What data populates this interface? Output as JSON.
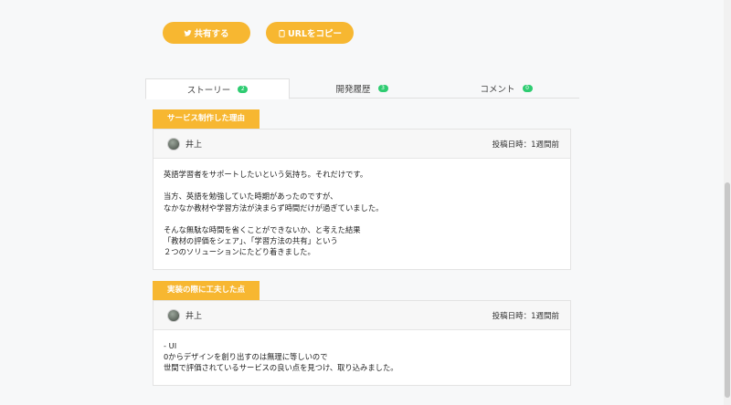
{
  "share": {
    "twitter_label": "共有する",
    "copy_label": "URLをコピー"
  },
  "tabs": [
    {
      "label": "ストーリー",
      "count": "2",
      "active": true
    },
    {
      "label": "開発履歴",
      "count": "3",
      "active": false
    },
    {
      "label": "コメント",
      "count": "0",
      "active": false
    }
  ],
  "sections": [
    {
      "title": "サービス制作した理由",
      "author": "井上",
      "posted": "投稿日時：1週間前",
      "lines": [
        "英語学習者をサポートしたいという気持ち。それだけです。",
        "",
        "当方、英語を勉強していた時期があったのですが、",
        "なかなか教材や学習方法が決まらず時間だけが過ぎていました。",
        "",
        "そんな無駄な時間を省くことができないか、と考えた結果",
        "「教材の評価をシェア」、「学習方法の共有」という",
        "２つのソリューションにたどり着きました。"
      ]
    },
    {
      "title": "実装の際に工夫した点",
      "author": "井上",
      "posted": "投稿日時：1週間前",
      "lines": [
        "- UI",
        "0からデザインを創り出すのは無理に等しいので",
        "世間で評価されているサービスの良い点を見つけ、取り込みました。"
      ]
    }
  ],
  "colors": {
    "accent": "#f7b731",
    "badge": "#2ecc71",
    "background": "#f7f8f9"
  },
  "icons": {
    "twitter": "twitter-icon",
    "copy": "clipboard-icon"
  }
}
